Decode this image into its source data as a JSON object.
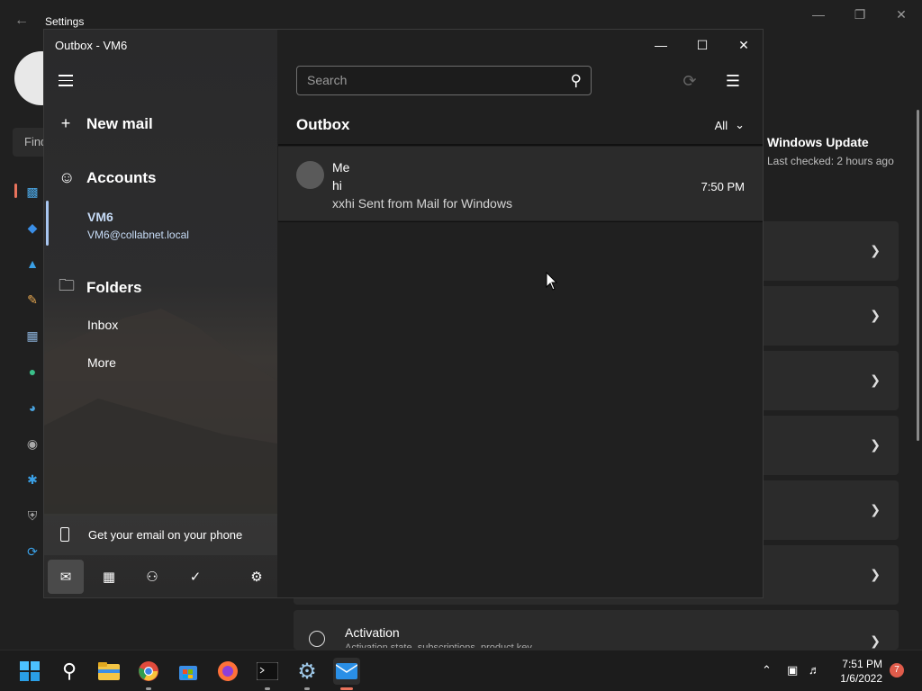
{
  "settings": {
    "title": "Settings",
    "find_placeholder": "Find",
    "windows_update_title": "Windows Update",
    "windows_update_sub": "Last checked: 2 hours ago",
    "activation_label": "Activation",
    "activation_sub": "Activation state, subscriptions, product key"
  },
  "mail": {
    "window_title": "Outbox - VM6",
    "new_mail": "New mail",
    "accounts": "Accounts",
    "account_name": "VM6",
    "account_email": "VM6@collabnet.local",
    "folders": "Folders",
    "folder_items": [
      "Inbox",
      "More"
    ],
    "phone_promo": "Get your email on your phone",
    "search_placeholder": "Search",
    "list_title": "Outbox",
    "filter_label": "All",
    "messages": [
      {
        "from": "Me",
        "subject": "hi",
        "preview": "xxhi Sent from Mail for Windows",
        "time": "7:50 PM"
      }
    ]
  },
  "taskbar": {
    "time": "7:51 PM",
    "date": "1/6/2022",
    "notification_count": "7"
  },
  "colors": {
    "accent": "#e9735c",
    "account_highlight": "#a8c6f0"
  }
}
